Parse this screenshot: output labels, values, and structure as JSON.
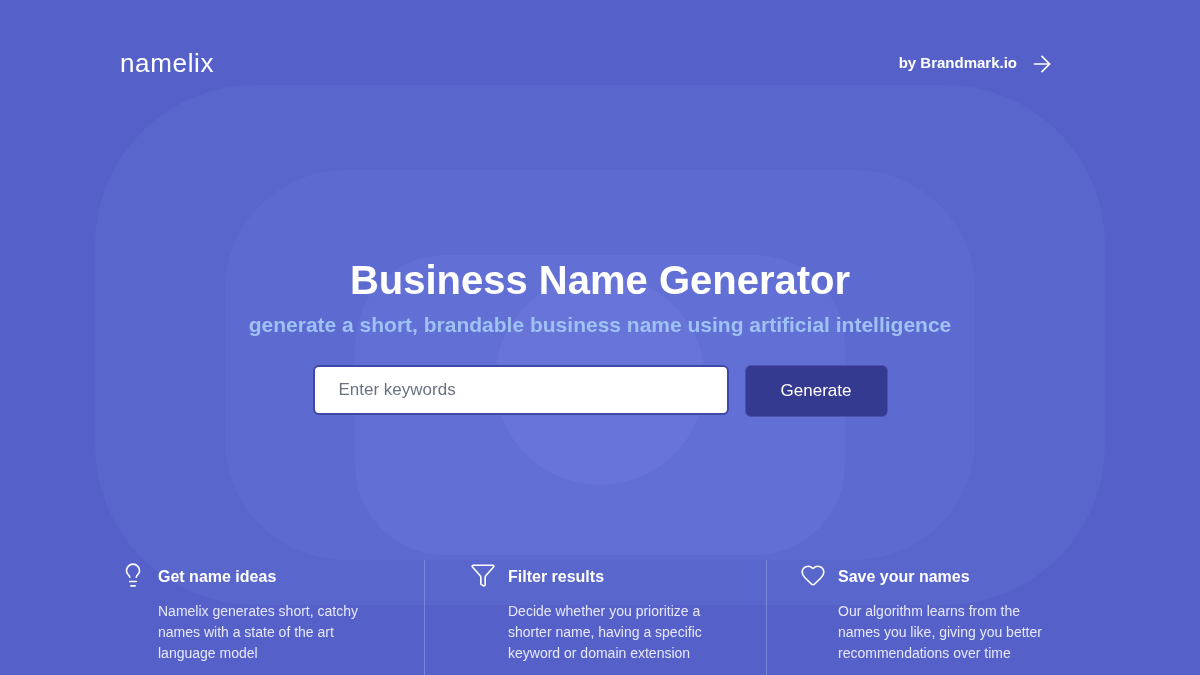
{
  "header": {
    "logo": "namelix",
    "link": "by Brandmark.io"
  },
  "hero": {
    "title": "Business Name Generator",
    "subtitle": "generate a short, brandable business name using artificial intelligence",
    "search": {
      "placeholder": "Enter keywords"
    },
    "button": "Generate"
  },
  "features": [
    {
      "kind": "idea",
      "title": "Get name ideas",
      "description": "Namelix generates short, catchy names with a state of the art language model"
    },
    {
      "kind": "filter",
      "title": "Filter results",
      "description": "Decide whether you prioritize a shorter name, having a specific keyword or domain extension"
    },
    {
      "kind": "save",
      "title": "Save your names",
      "description": "Our algorithm learns from the names you like, giving you better recommendations over time"
    }
  ]
}
